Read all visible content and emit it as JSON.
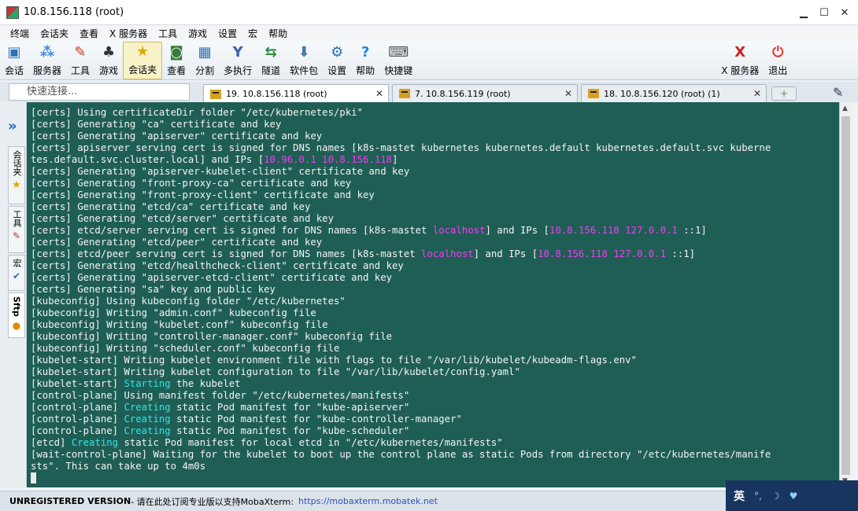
{
  "window": {
    "title": "10.8.156.118 (root)"
  },
  "menu": [
    "终端",
    "会话夹",
    "查看",
    "X 服务器",
    "工具",
    "游戏",
    "设置",
    "宏",
    "帮助"
  ],
  "toolbar": [
    {
      "label": "会话",
      "icon": "monitor-session-icon",
      "glyph": "▣",
      "color": "#2a6fb8"
    },
    {
      "label": "服务器",
      "icon": "servers-dots-icon",
      "glyph": "⁂",
      "color": "#4488dd"
    },
    {
      "label": "工具",
      "icon": "tools-icon",
      "glyph": "✎",
      "color": "#c0392b"
    },
    {
      "label": "游戏",
      "icon": "games-icon",
      "glyph": "♣",
      "color": "#333333"
    },
    {
      "label": "会话夹",
      "icon": "star-icon",
      "glyph": "★",
      "color": "#e0a800"
    },
    {
      "label": "查看",
      "icon": "view-icon",
      "glyph": "◙",
      "color": "#3a7a3a"
    },
    {
      "label": "分割",
      "icon": "split-icon",
      "glyph": "▦",
      "color": "#2a6fb8"
    },
    {
      "label": "多执行",
      "icon": "multi-exec-icon",
      "glyph": "Y",
      "color": "#3a5fb0"
    },
    {
      "label": "隧道",
      "icon": "tunnel-icon",
      "glyph": "⇆",
      "color": "#2a8a3a"
    },
    {
      "label": "软件包",
      "icon": "packages-icon",
      "glyph": "⬇",
      "color": "#4477aa"
    },
    {
      "label": "设置",
      "icon": "settings-gear-icon",
      "glyph": "⚙",
      "color": "#2a6fb8"
    },
    {
      "label": "帮助",
      "icon": "help-icon",
      "glyph": "?",
      "color": "#1e88e5"
    },
    {
      "label": "快捷键",
      "icon": "keyboard-icon",
      "glyph": "⌨",
      "color": "#555555"
    },
    {
      "label": "X 服务器",
      "icon": "x-server-icon",
      "glyph": "X",
      "color": "#cc2222"
    },
    {
      "label": "退出",
      "icon": "power-icon",
      "glyph": "⏻",
      "color": "#e53935"
    }
  ],
  "quick_connect": {
    "placeholder": "快速连接..."
  },
  "tabs": [
    {
      "label": "19. 10.8.156.118 (root)",
      "active": true
    },
    {
      "label": "7. 10.8.156.119 (root)",
      "active": false
    },
    {
      "label": "18. 10.8.156.120 (root) (1)",
      "active": false
    }
  ],
  "side_tabs": [
    "会话夹",
    "工具",
    "宏",
    "Sftp"
  ],
  "terminal_lines": [
    [
      {
        "t": "[certs] Using certificateDir folder \"/etc/kubernetes/pki\""
      }
    ],
    [
      {
        "t": "[certs] Generating \"ca\" certificate and key"
      }
    ],
    [
      {
        "t": "[certs] Generating \"apiserver\" certificate and key"
      }
    ],
    [
      {
        "t": "[certs] apiserver serving cert is signed for DNS names [k8s-mastet kubernetes kubernetes.default kubernetes.default.svc kuberne"
      }
    ],
    [
      {
        "t": "tes.default.svc.cluster.local] and IPs ["
      },
      {
        "t": "10.96.0.1 10.8.156.118",
        "c": "mag"
      },
      {
        "t": "]"
      }
    ],
    [
      {
        "t": "[certs] Generating \"apiserver-kubelet-client\" certificate and key"
      }
    ],
    [
      {
        "t": "[certs] Generating \"front-proxy-ca\" certificate and key"
      }
    ],
    [
      {
        "t": "[certs] Generating \"front-proxy-client\" certificate and key"
      }
    ],
    [
      {
        "t": "[certs] Generating \"etcd/ca\" certificate and key"
      }
    ],
    [
      {
        "t": "[certs] Generating \"etcd/server\" certificate and key"
      }
    ],
    [
      {
        "t": "[certs] etcd/server serving cert is signed for DNS names [k8s-mastet "
      },
      {
        "t": "localhost",
        "c": "mag"
      },
      {
        "t": "] and IPs ["
      },
      {
        "t": "10.8.156.118 127.0.0.1",
        "c": "mag"
      },
      {
        "t": " ::1]"
      }
    ],
    [
      {
        "t": "[certs] Generating \"etcd/peer\" certificate and key"
      }
    ],
    [
      {
        "t": "[certs] etcd/peer serving cert is signed for DNS names [k8s-mastet "
      },
      {
        "t": "localhost",
        "c": "mag"
      },
      {
        "t": "] and IPs ["
      },
      {
        "t": "10.8.156.118 127.0.0.1",
        "c": "mag"
      },
      {
        "t": " ::1]"
      }
    ],
    [
      {
        "t": "[certs] Generating \"etcd/healthcheck-client\" certificate and key"
      }
    ],
    [
      {
        "t": "[certs] Generating \"apiserver-etcd-client\" certificate and key"
      }
    ],
    [
      {
        "t": "[certs] Generating \"sa\" key and public key"
      }
    ],
    [
      {
        "t": "[kubeconfig] Using kubeconfig folder \"/etc/kubernetes\""
      }
    ],
    [
      {
        "t": "[kubeconfig] Writing \"admin.conf\" kubeconfig file"
      }
    ],
    [
      {
        "t": "[kubeconfig] Writing \"kubelet.conf\" kubeconfig file"
      }
    ],
    [
      {
        "t": "[kubeconfig] Writing \"controller-manager.conf\" kubeconfig file"
      }
    ],
    [
      {
        "t": "[kubeconfig] Writing \"scheduler.conf\" kubeconfig file"
      }
    ],
    [
      {
        "t": "[kubelet-start] Writing kubelet environment file with flags to file \"/var/lib/kubelet/kubeadm-flags.env\""
      }
    ],
    [
      {
        "t": "[kubelet-start] Writing kubelet configuration to file \"/var/lib/kubelet/config.yaml\""
      }
    ],
    [
      {
        "t": "[kubelet-start] "
      },
      {
        "t": "Starting",
        "c": "cyn"
      },
      {
        "t": " the kubelet"
      }
    ],
    [
      {
        "t": "[control-plane] Using manifest folder \"/etc/kubernetes/manifests\""
      }
    ],
    [
      {
        "t": "[control-plane] "
      },
      {
        "t": "Creating",
        "c": "cyn"
      },
      {
        "t": " static Pod manifest for \"kube-apiserver\""
      }
    ],
    [
      {
        "t": "[control-plane] "
      },
      {
        "t": "Creating",
        "c": "cyn"
      },
      {
        "t": " static Pod manifest for \"kube-controller-manager\""
      }
    ],
    [
      {
        "t": "[control-plane] "
      },
      {
        "t": "Creating",
        "c": "cyn"
      },
      {
        "t": " static Pod manifest for \"kube-scheduler\""
      }
    ],
    [
      {
        "t": "[etcd] "
      },
      {
        "t": "Creating",
        "c": "cyn"
      },
      {
        "t": " static Pod manifest for local etcd in \"/etc/kubernetes/manifests\""
      }
    ],
    [
      {
        "t": "[wait-control-plane] Waiting for the kubelet to boot up the control plane as static Pods from directory \"/etc/kubernetes/manife"
      }
    ],
    [
      {
        "t": "sts\". This can take up to 4m0s"
      }
    ]
  ],
  "status": {
    "version": "UNREGISTERED VERSION",
    "message": " - 请在此处订阅专业版以支持MobaXterm: ",
    "link": "https://mobaxterm.mobatek.net"
  },
  "ime": {
    "label": "英"
  }
}
